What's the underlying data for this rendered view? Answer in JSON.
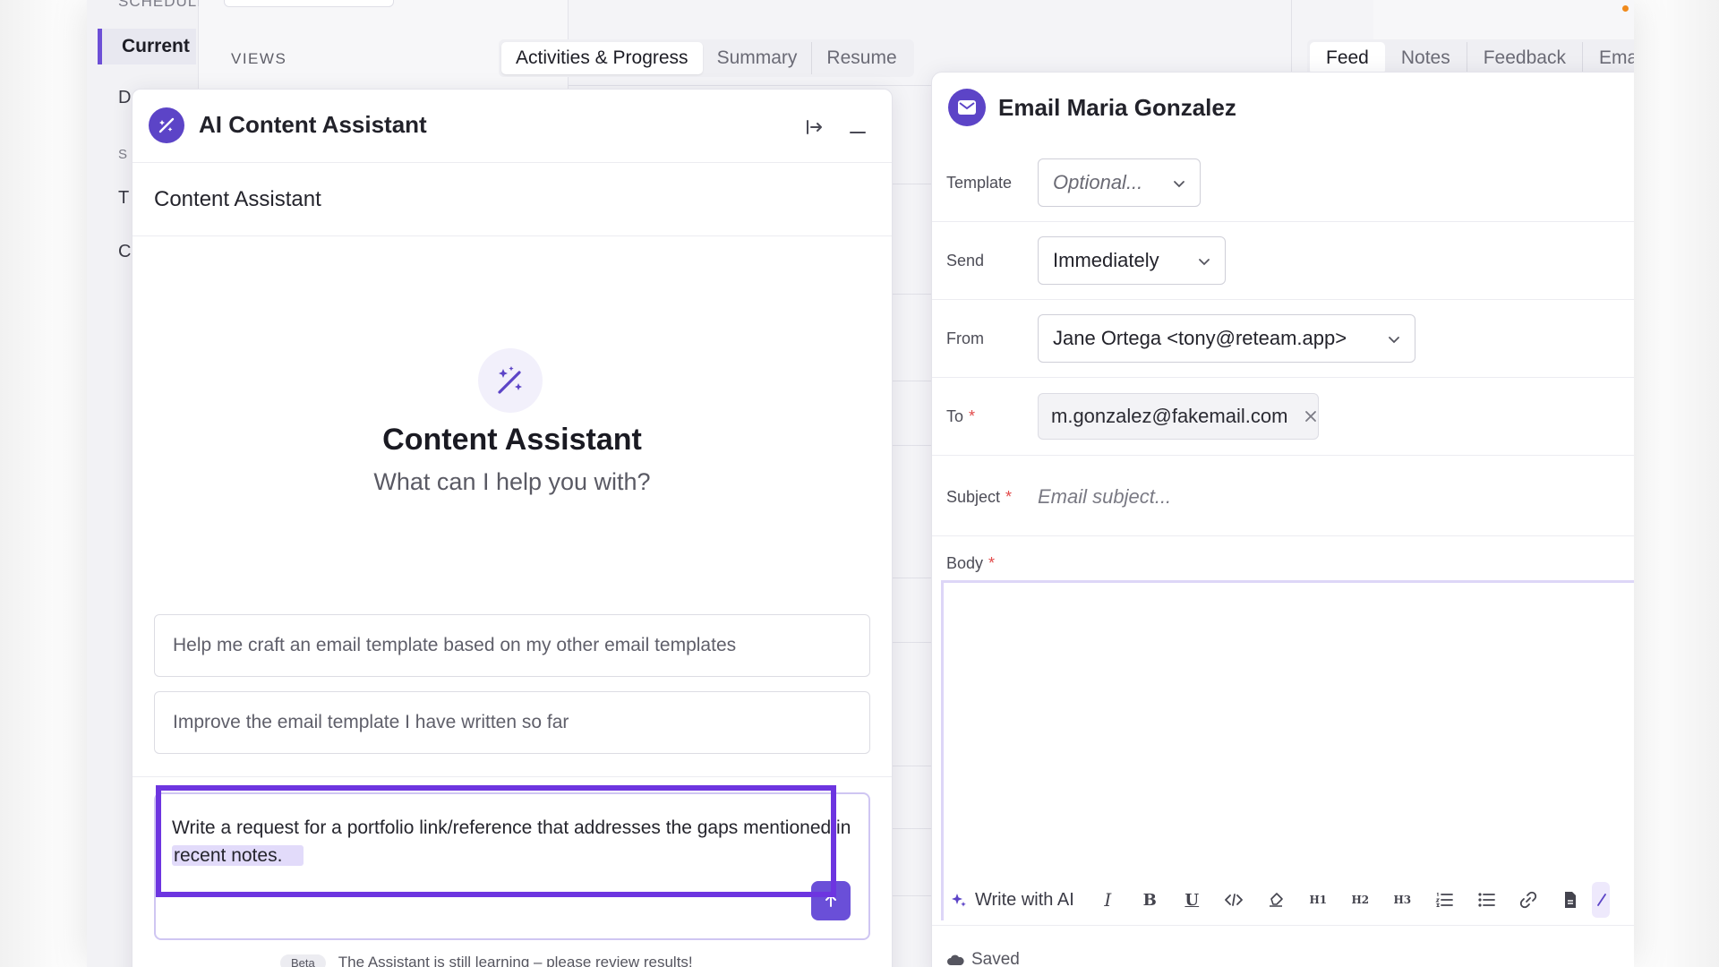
{
  "background": {
    "sidebar": {
      "section_cut": "SCHEDULI",
      "current_label": "Current",
      "fragments": [
        "D",
        "S",
        "T",
        "C"
      ]
    },
    "views_label": "VIEWS",
    "center_tabs": [
      "Activities & Progress",
      "Summary",
      "Resume"
    ],
    "right_tabs": [
      "Feed",
      "Notes",
      "Feedback",
      "Ema"
    ]
  },
  "ai_panel": {
    "title": "AI Content Assistant",
    "subheader": "Content Assistant",
    "hero_title": "Content Assistant",
    "hero_subtitle": "What can I help you with?",
    "suggestions": [
      "Help me craft an email template based on my other email templates",
      "Improve the email template I have written so far"
    ],
    "prompt": {
      "text": "Write a request for a portfolio link/reference that addresses the gaps mentioned in",
      "highlighted": "recent notes."
    },
    "beta_badge": "Beta",
    "beta_text": "The Assistant is still learning – please review results!"
  },
  "email_panel": {
    "title": "Email Maria Gonzalez",
    "fields": {
      "template_label": "Template",
      "template_value": "Optional...",
      "send_label": "Send",
      "send_value": "Immediately",
      "from_label": "From",
      "from_value": "Jane Ortega <tony@reteam.app>",
      "to_label": "To",
      "to_chip": "m.gonzalez@fakemail.com",
      "subject_label": "Subject",
      "subject_placeholder": "Email subject...",
      "body_label": "Body",
      "required_mark": "*"
    },
    "toolbar": {
      "write_ai": "Write with AI",
      "italic": "I",
      "bold": "B",
      "underline": "U",
      "h1": "H1",
      "h2": "H2",
      "h3": "H3"
    },
    "status": "Saved"
  },
  "colors": {
    "brand_purple": "#5c44c7",
    "accent_purple": "#6a4fd8",
    "highlight_outline": "#6d35e0",
    "required_red": "#e24a4a"
  }
}
